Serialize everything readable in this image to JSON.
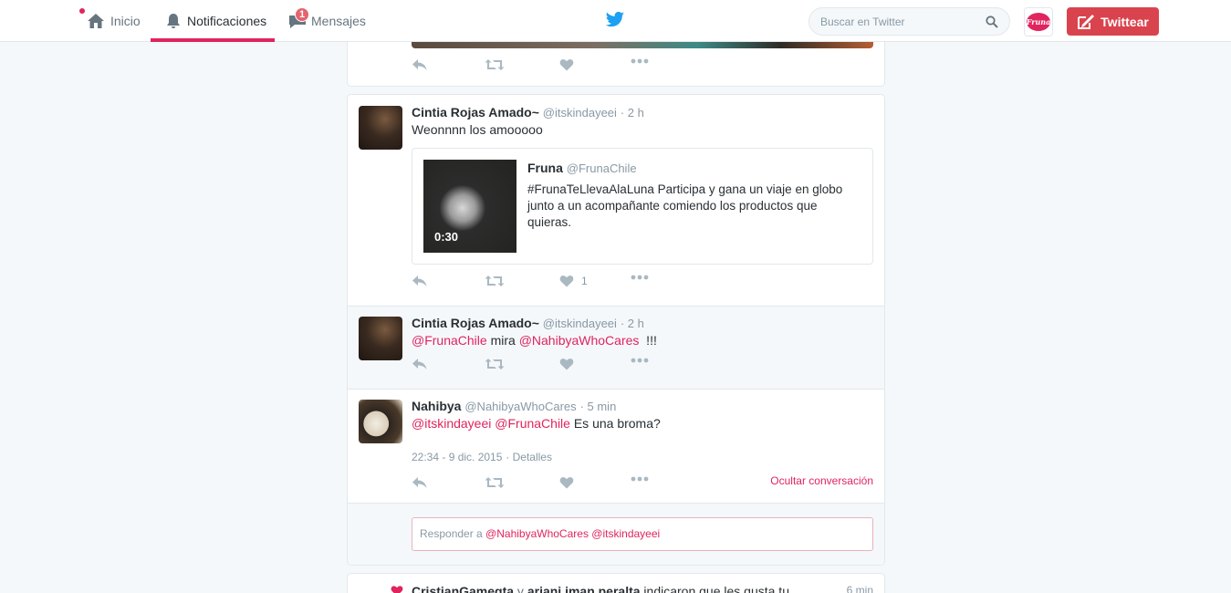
{
  "nav": {
    "home": "Inicio",
    "notifications": "Notificaciones",
    "messages": "Mensajes",
    "messages_badge": "1"
  },
  "search": {
    "placeholder": "Buscar en Twitter"
  },
  "profile_logo": "Fruna",
  "tweet_button": "Twittear",
  "tweets": [
    {
      "name": "Cintia Rojas Amado~",
      "handle": "@itskindayeei",
      "time": "· 2 h",
      "text": "Weonnnn los amooooo",
      "quote": {
        "name": "Fruna",
        "handle": "@FrunaChile",
        "text": "#FrunaTeLlevaAlaLuna Participa y gana un viaje en globo junto a un acompañante comiendo los productos que quieras.",
        "video_duration": "0:30"
      },
      "likes": "1"
    },
    {
      "name": "Cintia Rojas Amado~",
      "handle": "@itskindayeei",
      "time": "· 2 h",
      "mention1": "@FrunaChile",
      "mid": " mira ",
      "mention2": "@NahibyaWhoCares",
      "end": "  !!!"
    },
    {
      "name": "Nahibya",
      "handle": "@NahibyaWhoCares",
      "time": "· 5 min",
      "mention1": "@itskindayeei",
      "mention2": "@FrunaChile",
      "end": " Es una broma?",
      "date": "22:34 - 9 dic. 2015",
      "details": "· Detalles",
      "hide": "Ocultar conversación"
    }
  ],
  "reply": {
    "prefix": "Responder a ",
    "to1": "@NahibyaWhoCares",
    "to2": "@itskindayeei"
  },
  "bottom_notification": {
    "user1": "CristianGamegta",
    "conj": " y ",
    "user2": "ariani iman peralta",
    "text": " indicaron que les gusta tu",
    "time": "6 min"
  },
  "colors": {
    "accent": "#e0245e",
    "button": "#d9434d",
    "twitter_blue": "#1da1f2"
  }
}
